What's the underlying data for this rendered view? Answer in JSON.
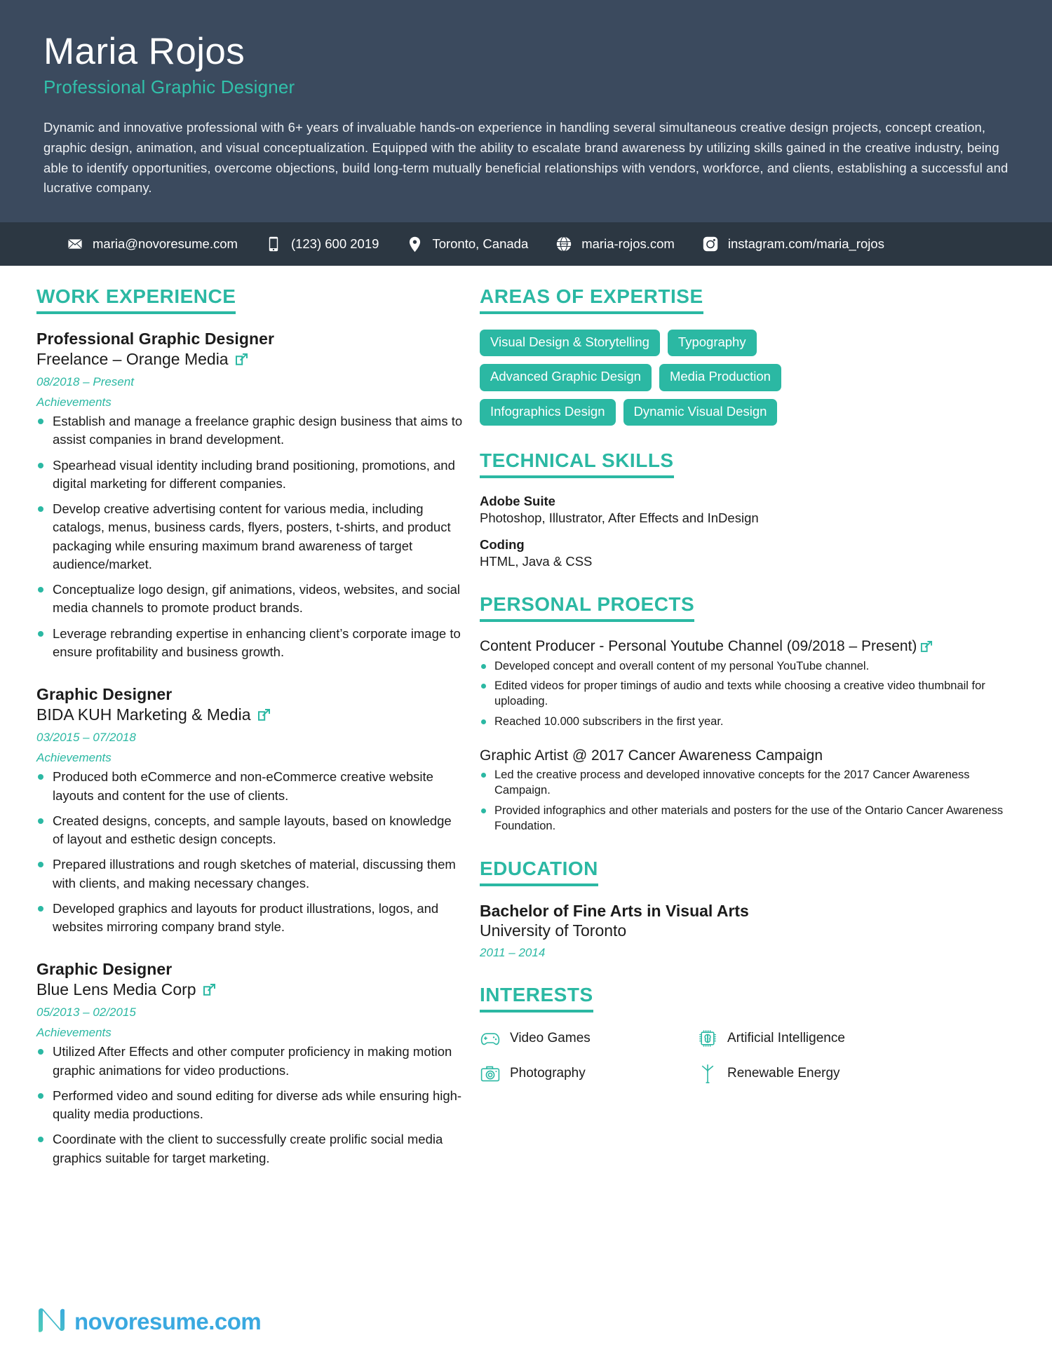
{
  "header": {
    "name": "Maria Rojos",
    "title": "Professional Graphic Designer",
    "summary": "Dynamic and innovative professional with 6+ years of invaluable hands-on experience in handling several simultaneous creative design projects, concept creation, graphic design, animation, and visual conceptualization. Equipped with the ability to escalate brand awareness by utilizing skills gained in the creative industry, being able to identify opportunities, overcome objections, build long-term mutually beneficial relationships with vendors, workforce, and clients, establishing a successful and lucrative company.",
    "bg_color": "#3b4a5e",
    "accent_color": "#2bb8a3"
  },
  "contact": {
    "bg_color": "#2c3742",
    "items": [
      {
        "icon": "envelope-icon",
        "text": "maria@novoresume.com"
      },
      {
        "icon": "phone-icon",
        "text": "(123) 600 2019"
      },
      {
        "icon": "location-pin-icon",
        "text": "Toronto, Canada"
      },
      {
        "icon": "globe-www-icon",
        "text": "maria-rojos.com"
      },
      {
        "icon": "instagram-icon",
        "text": "instagram.com/maria_rojos"
      }
    ]
  },
  "work_experience": {
    "heading": "WORK EXPERIENCE",
    "jobs": [
      {
        "title": "Professional Graphic Designer",
        "company": "Freelance – Orange Media",
        "dates": "08/2018 – Present",
        "achievements_label": "Achievements",
        "bullets": [
          "Establish and manage a freelance graphic design business that aims to assist companies in brand development.",
          "Spearhead visual identity including brand positioning, promotions, and digital marketing for different companies.",
          "Develop creative advertising content for various media, including catalogs, menus, business cards, flyers, posters, t-shirts, and product packaging while ensuring maximum brand awareness of target audience/market.",
          "Conceptualize logo design, gif animations, videos, websites, and social media channels to promote product brands.",
          "Leverage rebranding expertise in enhancing client’s corporate image to ensure profitability and business growth."
        ]
      },
      {
        "title": "Graphic Designer",
        "company": "BIDA KUH Marketing & Media",
        "dates": "03/2015 – 07/2018",
        "achievements_label": "Achievements",
        "bullets": [
          "Produced both eCommerce and non-eCommerce creative website layouts and content for the use of clients.",
          "Created designs, concepts, and sample layouts, based on knowledge of layout and esthetic design concepts.",
          "Prepared illustrations and rough sketches of material, discussing them with clients, and making necessary changes.",
          "Developed graphics and layouts for product illustrations, logos, and websites mirroring company brand style."
        ]
      },
      {
        "title": "Graphic Designer",
        "company": "Blue Lens Media Corp",
        "dates": "05/2013 – 02/2015",
        "achievements_label": "Achievements",
        "bullets": [
          "Utilized After Effects and other computer proficiency in making motion graphic animations for video productions.",
          "Performed video and sound editing for diverse ads while ensuring high-quality media productions.",
          "Coordinate with the client to successfully create prolific social media graphics suitable for target marketing."
        ]
      }
    ]
  },
  "areas_of_expertise": {
    "heading": "AREAS OF EXPERTISE",
    "tags": [
      "Visual Design & Storytelling",
      "Typography",
      "Advanced Graphic Design",
      "Media Production",
      "Infographics Design",
      "Dynamic Visual Design"
    ]
  },
  "technical_skills": {
    "heading": "TECHNICAL SKILLS",
    "groups": [
      {
        "name": "Adobe Suite",
        "items": "Photoshop, Illustrator, After Effects and InDesign"
      },
      {
        "name": "Coding",
        "items": "HTML, Java & CSS"
      }
    ]
  },
  "personal_projects": {
    "heading": "PERSONAL PROECTS",
    "projects": [
      {
        "title": "Content Producer - Personal Youtube Channel (09/2018 – Present)",
        "has_link": true,
        "bullets": [
          "Developed concept and overall content of my personal YouTube channel.",
          "Edited videos for proper timings of audio and texts while choosing a creative video thumbnail for uploading.",
          "Reached 10.000 subscribers in the first year."
        ]
      },
      {
        "title": "Graphic Artist @ 2017 Cancer Awareness Campaign",
        "has_link": false,
        "bullets": [
          "Led the creative process and developed innovative concepts for the 2017 Cancer Awareness Campaign.",
          "Provided infographics and other materials and posters for the use of the Ontario Cancer Awareness Foundation."
        ]
      }
    ]
  },
  "education": {
    "heading": "EDUCATION",
    "degree": "Bachelor of Fine Arts in Visual Arts",
    "school": "University of Toronto",
    "dates": "2011 – 2014"
  },
  "interests": {
    "heading": "INTERESTS",
    "items": [
      {
        "icon": "gamepad-icon",
        "label": "Video Games"
      },
      {
        "icon": "ai-chip-brain-icon",
        "label": "Artificial Intelligence"
      },
      {
        "icon": "camera-icon",
        "label": "Photography"
      },
      {
        "icon": "wind-turbine-icon",
        "label": "Renewable Energy"
      }
    ]
  },
  "footer": {
    "logo_text": "novoresume.com",
    "logo_mark": "novoresume-n-icon"
  }
}
